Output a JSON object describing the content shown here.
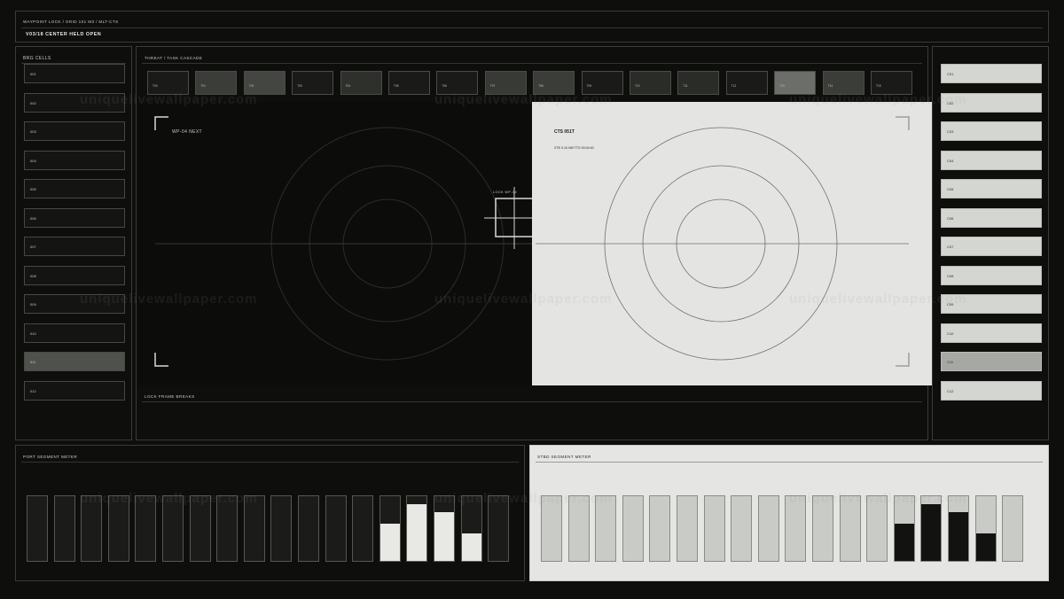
{
  "header": {
    "path": "WAYPOINT LOCK / GRID 101 M3 / MLT-CTS",
    "title": "V03/18  CENTER HELD OPEN"
  },
  "left_panel": {
    "title": "BRG CELLS",
    "cells": [
      "001",
      "002",
      "003",
      "004",
      "005",
      "006",
      "007",
      "008",
      "009",
      "010",
      "011",
      "012"
    ],
    "active_index": 10
  },
  "right_panel": {
    "cells": [
      "C01",
      "C02",
      "C03",
      "C04",
      "C05",
      "C06",
      "C07",
      "C08",
      "C09",
      "C10",
      "C11",
      "C12"
    ],
    "active_index": 10
  },
  "cascade": {
    "title": "THREAT / TASK CASCADE",
    "cells": [
      {
        "label": "T00",
        "shade": "#1a1b19"
      },
      {
        "label": "T01",
        "shade": "#3b3d39"
      },
      {
        "label": "T02",
        "shade": "#444642"
      },
      {
        "label": "T03",
        "shade": "#1a1b19"
      },
      {
        "label": "T04",
        "shade": "#2e302c"
      },
      {
        "label": "T05",
        "shade": "#1a1b19"
      },
      {
        "label": "T06",
        "shade": "#1a1b19"
      },
      {
        "label": "T07",
        "shade": "#383a36"
      },
      {
        "label": "T08",
        "shade": "#3b3d39"
      },
      {
        "label": "T09",
        "shade": "#1a1b19"
      },
      {
        "label": "T10",
        "shade": "#2a2c28"
      },
      {
        "label": "T11",
        "shade": "#2a2c28"
      },
      {
        "label": "T12",
        "shade": "#1a1b19"
      },
      {
        "label": "T13",
        "shade": "#6c6e69"
      },
      {
        "label": "T14",
        "shade": "#3b3d39"
      },
      {
        "label": "T15",
        "shade": "#1a1b19"
      }
    ]
  },
  "scope": {
    "left_label": "WP-04  NEXT",
    "lock_label": "LOCK WP-04",
    "right_title": "CTS 051T",
    "right_sub": "XTE  0.10 NM    TTG  00:04:40"
  },
  "frame_label": "LOCK FRAME  BREAKS",
  "port": {
    "title": "PORT SEGMENT METER",
    "levels": [
      0,
      0,
      0,
      0,
      0,
      0,
      0,
      0,
      0,
      0,
      0,
      0,
      0,
      0.57,
      0.88,
      0.75,
      0.43,
      0
    ]
  },
  "stbd": {
    "title": "STBD SEGMENT METER",
    "levels": [
      0,
      0,
      0,
      0,
      0,
      0,
      0,
      0,
      0,
      0,
      0,
      0,
      0,
      0.57,
      0.88,
      0.75,
      0.43,
      0
    ]
  },
  "watermark": "uniquelivewallpaper.com"
}
